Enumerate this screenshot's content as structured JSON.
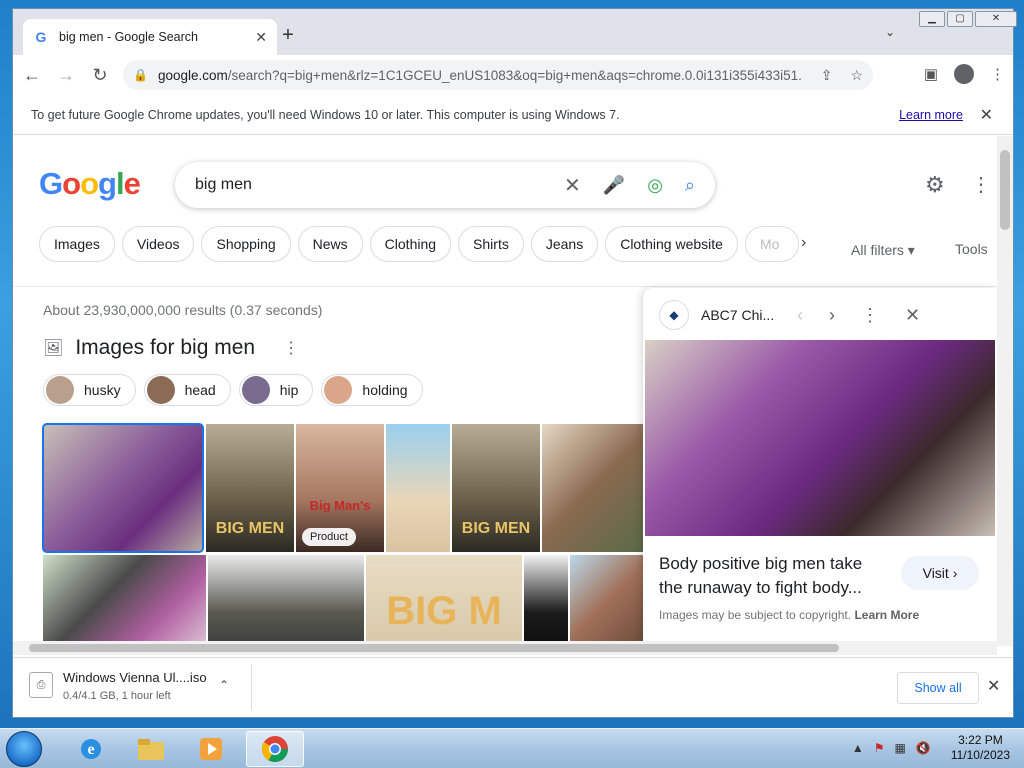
{
  "browser": {
    "tab_title": "big men - Google Search",
    "new_tab": "+",
    "address": {
      "host": "google.com",
      "rest": "/search?q=big+men&rlz=1C1GCEU_enUS1083&oq=big+men&aqs=chrome.0.0i131i355i433i51..."
    }
  },
  "infobar": {
    "message": "To get future Google Chrome updates, you'll need Windows 10 or later. This computer is using Windows 7.",
    "learn_more": "Learn more"
  },
  "search": {
    "query": "big men",
    "logo": [
      "G",
      "o",
      "o",
      "g",
      "l",
      "e"
    ]
  },
  "chips": [
    "Images",
    "Videos",
    "Shopping",
    "News",
    "Clothing",
    "Shirts",
    "Jeans",
    "Clothing website",
    "Mo"
  ],
  "filters": {
    "all": "All filters",
    "tools": "Tools"
  },
  "results": {
    "stats": "About 23,930,000,000 results (0.37 seconds)",
    "images_heading": "Images for big men",
    "refinements": [
      "husky",
      "head",
      "hip",
      "holding"
    ]
  },
  "grid": {
    "product_badge": "Product",
    "poster_text_1": "BIG MEN",
    "poster_text_2": "Big Man's",
    "poster_banner": "BIG M"
  },
  "panel": {
    "source": "ABC7 Chi...",
    "title": "Body positive big men take the runaway to fight body...",
    "visit": "Visit",
    "copyright": "Images may be subject to copyright.",
    "learn_more": "Learn More"
  },
  "download": {
    "name": "Windows Vienna Ul....iso",
    "status": "0.4/4.1 GB, 1 hour left",
    "show_all": "Show all"
  },
  "taskbar": {
    "time": "3:22 PM",
    "date": "11/10/2023"
  }
}
